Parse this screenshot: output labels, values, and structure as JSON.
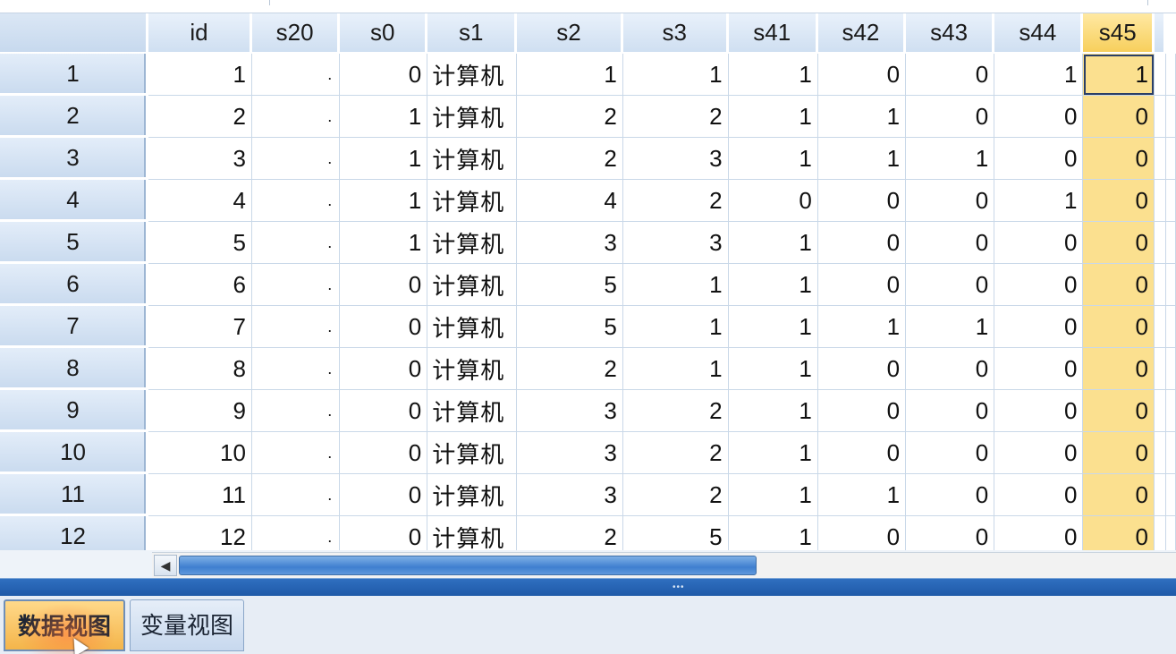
{
  "columns": [
    "id",
    "s20",
    "s0",
    "s1",
    "s2",
    "s3",
    "s41",
    "s42",
    "s43",
    "s44",
    "s45"
  ],
  "selected_column": "s45",
  "rows": [
    {
      "num": "1",
      "cells": [
        "1",
        ".",
        "0",
        "计算机",
        "1",
        "1",
        "1",
        "0",
        "0",
        "1",
        "1"
      ]
    },
    {
      "num": "2",
      "cells": [
        "2",
        ".",
        "1",
        "计算机",
        "2",
        "2",
        "1",
        "1",
        "0",
        "0",
        "0"
      ]
    },
    {
      "num": "3",
      "cells": [
        "3",
        ".",
        "1",
        "计算机",
        "2",
        "3",
        "1",
        "1",
        "1",
        "0",
        "0"
      ]
    },
    {
      "num": "4",
      "cells": [
        "4",
        ".",
        "1",
        "计算机",
        "4",
        "2",
        "0",
        "0",
        "0",
        "1",
        "0"
      ]
    },
    {
      "num": "5",
      "cells": [
        "5",
        ".",
        "1",
        "计算机",
        "3",
        "3",
        "1",
        "0",
        "0",
        "0",
        "0"
      ]
    },
    {
      "num": "6",
      "cells": [
        "6",
        ".",
        "0",
        "计算机",
        "5",
        "1",
        "1",
        "0",
        "0",
        "0",
        "0"
      ]
    },
    {
      "num": "7",
      "cells": [
        "7",
        ".",
        "0",
        "计算机",
        "5",
        "1",
        "1",
        "1",
        "1",
        "0",
        "0"
      ]
    },
    {
      "num": "8",
      "cells": [
        "8",
        ".",
        "0",
        "计算机",
        "2",
        "1",
        "1",
        "0",
        "0",
        "0",
        "0"
      ]
    },
    {
      "num": "9",
      "cells": [
        "9",
        ".",
        "0",
        "计算机",
        "3",
        "2",
        "1",
        "0",
        "0",
        "0",
        "0"
      ]
    },
    {
      "num": "10",
      "cells": [
        "10",
        ".",
        "0",
        "计算机",
        "3",
        "2",
        "1",
        "0",
        "0",
        "0",
        "0"
      ]
    },
    {
      "num": "11",
      "cells": [
        "11",
        ".",
        "0",
        "计算机",
        "3",
        "2",
        "1",
        "1",
        "0",
        "0",
        "0"
      ]
    },
    {
      "num": "12",
      "cells": [
        "12",
        ".",
        "0",
        "计算机",
        "2",
        "5",
        "1",
        "0",
        "0",
        "0",
        "0"
      ]
    }
  ],
  "tabs": {
    "data_view": "数据视图",
    "variable_view": "变量视图"
  },
  "colors": {
    "selected_column": "#fbe08f",
    "header": "#cfdff1",
    "scroll_thumb": "#3f7fcf",
    "active_tab": "#f4b54a"
  },
  "icons": {
    "scroll_left": "scroll-left-arrow-icon"
  }
}
